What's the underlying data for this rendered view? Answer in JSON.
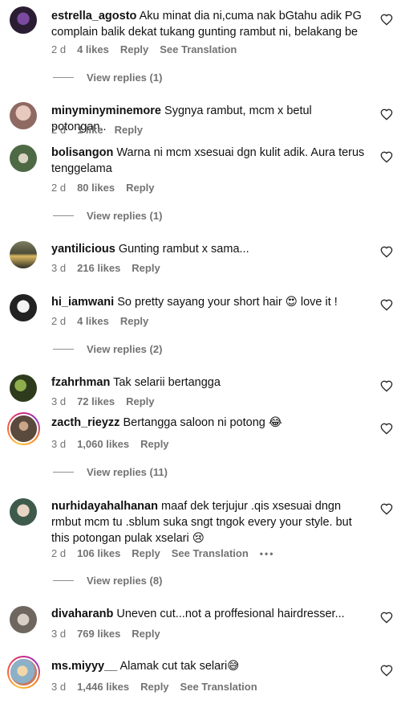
{
  "comments": [
    {
      "username": "estrella_agosto",
      "text": "Aku minat dia ni,cuma nak bGtahu adik PG complain balik dekat tukang gunting rambut ni, belakang be",
      "time": "2 d",
      "likes": "4 likes",
      "reply": "Reply",
      "translate": "See Translation",
      "replies": "View replies (1)"
    },
    {
      "username": "minyminyminemore",
      "text": "Sygnya rambut, mcm x betul potongan..",
      "time": "2 d",
      "likes": "1 like",
      "reply": "Reply"
    },
    {
      "username": "bolisangon",
      "text": "Warna ni mcm xsesuai dgn kulit adik. Aura terus tenggelama",
      "time": "2 d",
      "likes": "80 likes",
      "reply": "Reply",
      "replies": "View replies (1)"
    },
    {
      "username": "yantilicious",
      "text": "Gunting rambut x sama...",
      "time": "3 d",
      "likes": "216 likes",
      "reply": "Reply"
    },
    {
      "username": "hi_iamwani",
      "text": "So pretty sayang your short hair 😍 love it !",
      "time": "2 d",
      "likes": "4 likes",
      "reply": "Reply",
      "replies": "View replies (2)"
    },
    {
      "username": "fzahrhman",
      "text": "Tak selarii bertangga",
      "time": "3 d",
      "likes": "72 likes",
      "reply": "Reply"
    },
    {
      "username": "zacth_rieyzz",
      "text": "Bertangga saloon ni potong 😂",
      "time": "3 d",
      "likes": "1,060 likes",
      "reply": "Reply",
      "replies": "View replies (11)"
    },
    {
      "username": "nurhidayahalhanan",
      "text": "maaf dek terjujur .qis xsesuai dngn rmbut mcm tu .sblum suka sngt tngok every your style. but this potongan pulak xselari 😢",
      "time": "2 d",
      "likes": "106 likes",
      "reply": "Reply",
      "translate": "See Translation",
      "more": "•••",
      "replies": "View replies (8)"
    },
    {
      "username": "divaharanb",
      "text": "Uneven cut...not a proffesional hairdresser...",
      "time": "3 d",
      "likes": "769 likes",
      "reply": "Reply"
    },
    {
      "username": "ms.miyyy__",
      "text": "Alamak cut tak selari😅",
      "time": "3 d",
      "likes": "1,446 likes",
      "reply": "Reply",
      "translate": "See Translation"
    }
  ],
  "colors": {
    "text": "#111111",
    "meta": "#737373",
    "story_ring": [
      "#f9c33c",
      "#f56040",
      "#d62976",
      "#962fbf"
    ]
  },
  "icons": {
    "like": "heart-outline-icon"
  }
}
